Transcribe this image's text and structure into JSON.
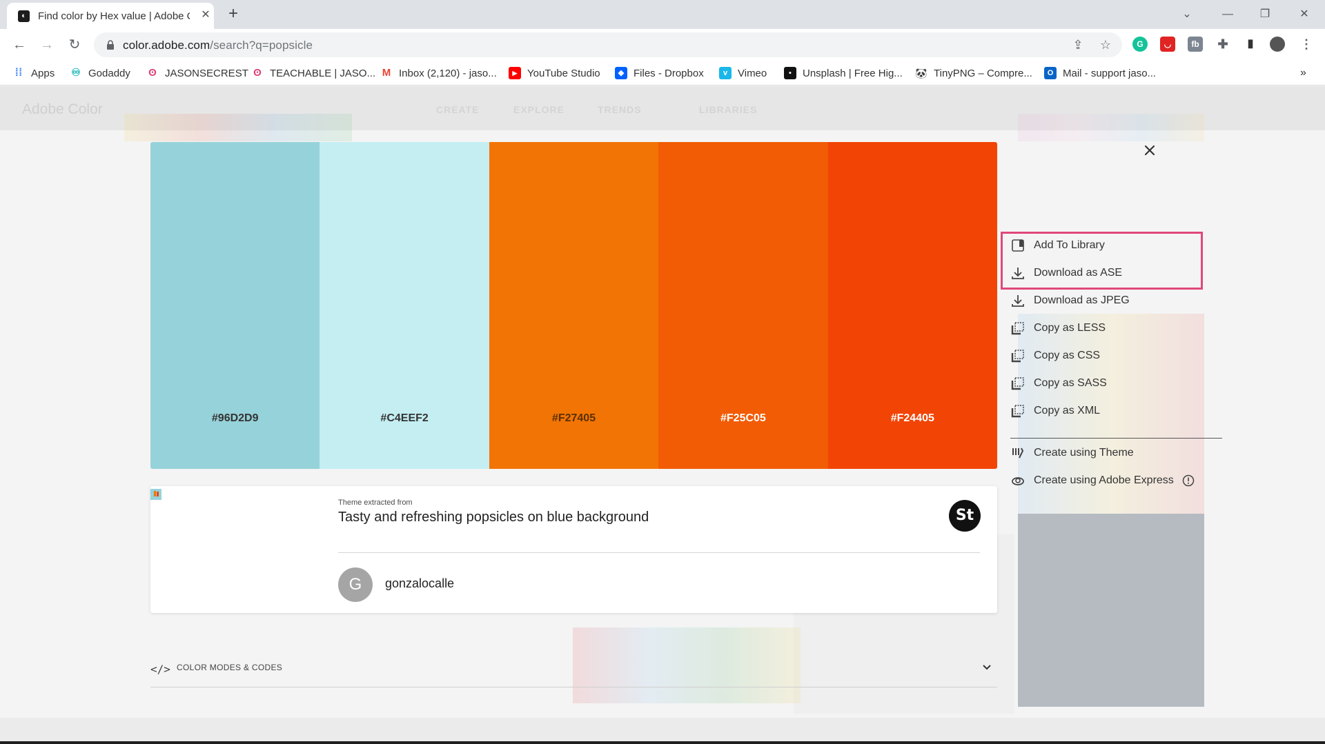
{
  "browser": {
    "tab_title": "Find color by Hex value | Adobe Color",
    "tab_close": "✕",
    "new_tab": "+",
    "url_host": "color.adobe.com",
    "url_path": "/search?q=popsicle",
    "bookmarks": [
      {
        "label": "Apps",
        "icon": "apps-grid-icon",
        "color": "#4285f4"
      },
      {
        "label": "Godaddy",
        "icon": "godaddy-icon",
        "color": "#1bdbdb"
      },
      {
        "label": "JASONSECREST",
        "icon": "teachable-icon",
        "color": "#e0407a"
      },
      {
        "label": "TEACHABLE | JASO...",
        "icon": "teachable-icon",
        "color": "#e0407a"
      },
      {
        "label": "Inbox (2,120) - jaso...",
        "icon": "gmail-icon",
        "color": "#ea4335"
      },
      {
        "label": "YouTube Studio",
        "icon": "youtube-icon",
        "color": "#ff0000"
      },
      {
        "label": "Files - Dropbox",
        "icon": "dropbox-icon",
        "color": "#0061ff"
      },
      {
        "label": "Vimeo",
        "icon": "vimeo-icon",
        "color": "#1ab7ea"
      },
      {
        "label": "Unsplash | Free Hig...",
        "icon": "unsplash-icon",
        "color": "#111111"
      },
      {
        "label": "TinyPNG – Compre...",
        "icon": "tinypng-icon",
        "color": "#7a9a3a"
      },
      {
        "label": "Mail - support jaso...",
        "icon": "outlook-icon",
        "color": "#0a64c8"
      }
    ],
    "bookmarks_more": "»"
  },
  "adobe_header": {
    "brand": "Adobe Color",
    "nav": [
      "CREATE",
      "EXPLORE",
      "TRENDS",
      "LIBRARIES"
    ]
  },
  "palette": {
    "swatches": [
      {
        "hex": "#96D2D9",
        "color": "#96d2d9",
        "text_color": "#333333"
      },
      {
        "hex": "#C4EEF2",
        "color": "#c4eef2",
        "text_color": "#333333"
      },
      {
        "hex": "#F27405",
        "color": "#f27405",
        "text_color": "#5a3000"
      },
      {
        "hex": "#F25C05",
        "color": "#f25c05",
        "text_color": "#ffffff"
      },
      {
        "hex": "#F24405",
        "color": "#f24405",
        "text_color": "#ffffff"
      }
    ]
  },
  "menu": {
    "items": [
      {
        "label": "Add To Library",
        "icon": "library-icon"
      },
      {
        "label": "Download as ASE",
        "icon": "download-icon"
      },
      {
        "label": "Download as JPEG",
        "icon": "download-icon"
      },
      {
        "label": "Copy as LESS",
        "icon": "copy-icon"
      },
      {
        "label": "Copy as CSS",
        "icon": "copy-icon"
      },
      {
        "label": "Copy as SASS",
        "icon": "copy-icon"
      },
      {
        "label": "Copy as XML",
        "icon": "copy-icon"
      }
    ],
    "create_items": [
      {
        "label": "Create using Theme",
        "icon": "theme-icon"
      },
      {
        "label": "Create using Adobe Express",
        "icon": "creative-cloud-icon"
      }
    ],
    "highlight_color": "#e0487a"
  },
  "card": {
    "extracted_label": "Theme extracted from",
    "title": "Tasty and refreshing popsicles on blue background",
    "stock_badge": "St",
    "avatar_letter": "G",
    "author": "gonzalocalle"
  },
  "color_modes": {
    "icon": "</>",
    "label": "COLOR MODES & CODES"
  }
}
